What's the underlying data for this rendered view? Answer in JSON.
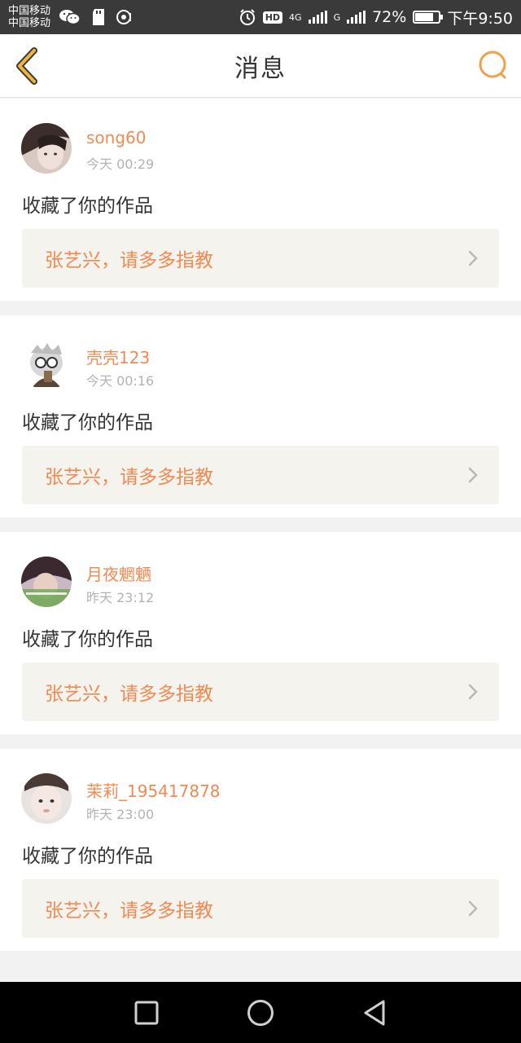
{
  "status_bar": {
    "carrier_1": "中国移动",
    "carrier_2": "中国移动",
    "network_4g": "4G",
    "network_g": "G",
    "hd": "HD",
    "battery": "72%",
    "time": "下午9:50"
  },
  "header": {
    "title": "消息",
    "accent_color": "#f0a14a"
  },
  "messages": [
    {
      "username": "song60",
      "time": "今天 00:29",
      "action": "收藏了你的作品",
      "work_title": "张艺兴，请多多指教",
      "avatar": "avatar-photo-1"
    },
    {
      "username": "壳壳123",
      "time": "今天 00:16",
      "action": "收藏了你的作品",
      "work_title": "张艺兴，请多多指教",
      "avatar": "avatar-cartoon"
    },
    {
      "username": "月夜魍魉",
      "time": "昨天 23:12",
      "action": "收藏了你的作品",
      "work_title": "张艺兴，请多多指教",
      "avatar": "avatar-photo-2"
    },
    {
      "username": "茉莉_195417878",
      "time": "昨天 23:00",
      "action": "收藏了你的作品",
      "work_title": "张艺兴，请多多指教",
      "avatar": "avatar-photo-3"
    }
  ],
  "nav": {
    "recent_icon": "square-icon",
    "home_icon": "circle-icon",
    "back_icon": "triangle-back-icon"
  }
}
